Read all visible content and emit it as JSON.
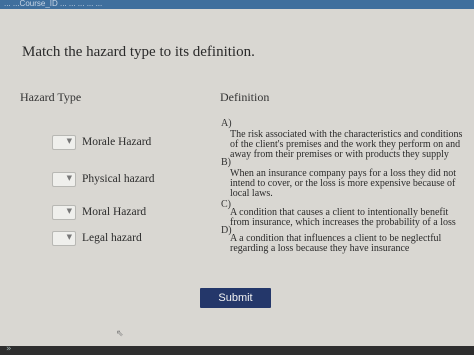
{
  "browser": {
    "url_fragment": "... ...Course_ID ... ... ... ... ..."
  },
  "question": {
    "title": "Match the hazard type to its definition."
  },
  "columns": {
    "hazard_type": "Hazard Type",
    "definition": "Definition"
  },
  "hazards": [
    {
      "label": "Morale Hazard",
      "selected": ""
    },
    {
      "label": "Physical hazard",
      "selected": ""
    },
    {
      "label": "Moral Hazard",
      "selected": ""
    },
    {
      "label": "Legal hazard",
      "selected": ""
    }
  ],
  "definitions": [
    {
      "letter": "A)",
      "text": "The risk associated with the characteristics and conditions of the client's premises and the work they perform on and away from their premises or with products they supply"
    },
    {
      "letter": "B)",
      "text": "When an insurance company pays for a loss they did not intend to cover, or the loss is more expensive because of local laws."
    },
    {
      "letter": "C)",
      "text": "A condition that causes a client to intentionally benefit from insurance, which increases the probability of a loss"
    },
    {
      "letter": "D)",
      "text": "A a condition that influences a client to be neglectful regarding a loss because they have insurance"
    }
  ],
  "actions": {
    "submit_label": "Submit"
  },
  "icons": {
    "dropdown": "chevron-down-icon",
    "cursor": "mouse-cursor-icon"
  },
  "colors": {
    "submit_bg": "#24376a",
    "page_bg": "#d9d7d2"
  }
}
